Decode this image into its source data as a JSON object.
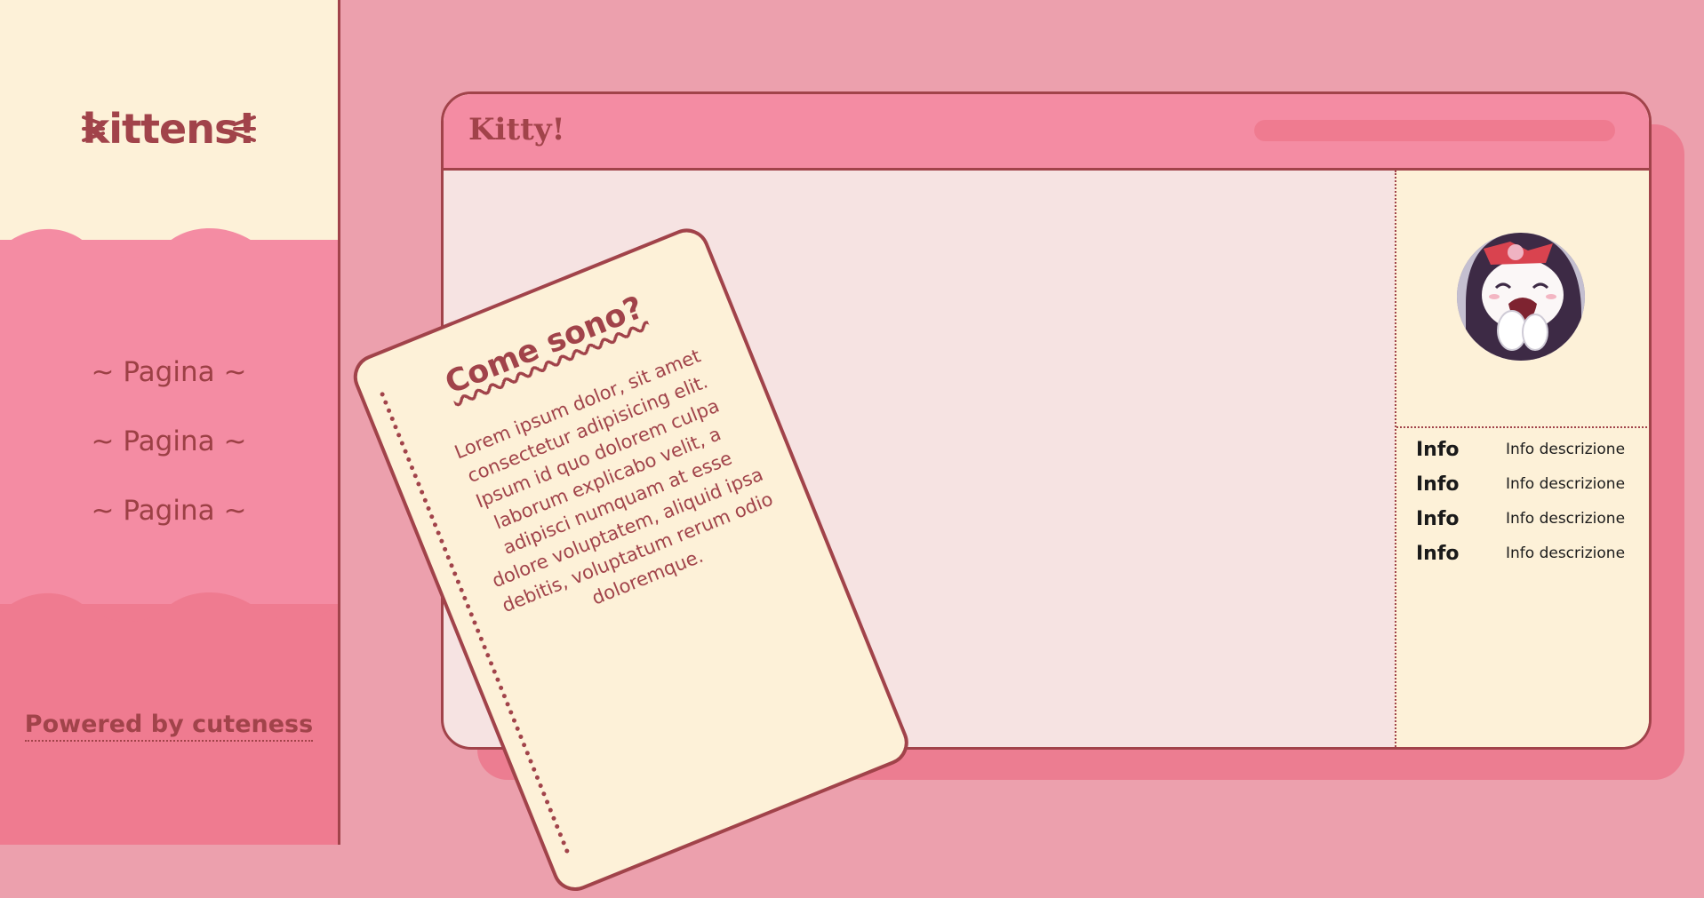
{
  "colors": {
    "background": "#eca0ad",
    "cream": "#fdf1d8",
    "pink": "#f48ca3",
    "dark_pink": "#ef7b90",
    "border": "#a1434a",
    "content_bg": "#f6e3e2"
  },
  "sidebar": {
    "logo": "kittens!",
    "nav": [
      {
        "label": "~ Pagina ~"
      },
      {
        "label": "~ Pagina ~"
      },
      {
        "label": "~ Pagina ~"
      }
    ],
    "footer": "Powered by cuteness"
  },
  "window": {
    "title": "Kitty!",
    "search_icon": "search-bar",
    "info": [
      {
        "key": "Info",
        "value": "Info descrizione"
      },
      {
        "key": "Info",
        "value": "Info descrizione"
      },
      {
        "key": "Info",
        "value": "Info descrizione"
      },
      {
        "key": "Info",
        "value": "Info descrizione"
      }
    ]
  },
  "card": {
    "title": "Come sono?",
    "body": "Lorem ipsum dolor, sit amet consectetur adipisicing elit. Ipsum id quo dolorem culpa laborum explicabo velit, a adipisci numquam at esse dolore voluptatem, aliquid ipsa debitis, voluptatum rerum odio doloremque."
  }
}
